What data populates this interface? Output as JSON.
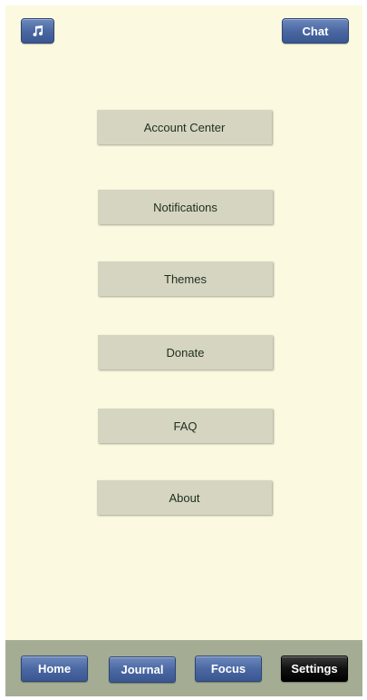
{
  "header": {
    "music_icon": "music-note-icon",
    "chat_label": "Chat"
  },
  "menu": [
    {
      "label": "Account Center"
    },
    {
      "label": "Notifications"
    },
    {
      "label": "Themes"
    },
    {
      "label": "Donate"
    },
    {
      "label": "FAQ"
    },
    {
      "label": "About"
    }
  ],
  "tabs": [
    {
      "label": "Home",
      "active": false
    },
    {
      "label": "Journal",
      "active": false
    },
    {
      "label": "Focus",
      "active": false
    },
    {
      "label": "Settings",
      "active": true
    }
  ],
  "colors": {
    "background": "#fbfae1",
    "menu_button": "#d6d5c1",
    "accent_blue": "#4b68a3",
    "tabbar": "#a4ad94",
    "active_tab": "#000000"
  }
}
